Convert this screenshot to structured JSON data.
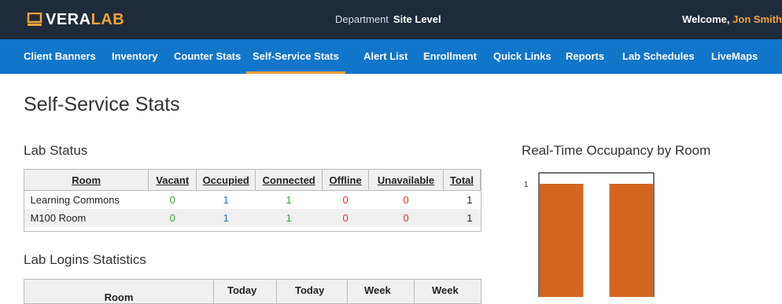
{
  "header": {
    "logo": {
      "part1": "VERA",
      "part2": "LAB"
    },
    "department_label": "Department",
    "department_value": "Site Level",
    "welcome_label": "Welcome,",
    "user_name": "Jon Smith",
    "accent_color": "#f0a23a"
  },
  "nav": {
    "items": [
      {
        "label": "Client Banners"
      },
      {
        "label": "Inventory"
      },
      {
        "label": "Counter Stats"
      },
      {
        "label": "Self-Service Stats"
      },
      {
        "label": "Alert List"
      },
      {
        "label": "Enrollment"
      },
      {
        "label": "Quick Links"
      },
      {
        "label": "Reports"
      },
      {
        "label": "Lab Schedules"
      },
      {
        "label": "LiveMaps"
      }
    ],
    "active": "Self-Service Stats"
  },
  "page": {
    "title": "Self-Service Stats"
  },
  "lab_status": {
    "title": "Lab Status",
    "columns": [
      "Room",
      "Vacant",
      "Occupied",
      "Connected",
      "Offline",
      "Unavailable",
      "Total"
    ],
    "rows": [
      {
        "room": "Learning Commons",
        "vacant": "0",
        "occupied": "1",
        "connected": "1",
        "offline": "0",
        "unavailable": "0",
        "total": "1"
      },
      {
        "room": "M100 Room",
        "vacant": "0",
        "occupied": "1",
        "connected": "1",
        "offline": "0",
        "unavailable": "0",
        "total": "1"
      }
    ]
  },
  "lab_logins": {
    "title": "Lab Logins Statistics",
    "columns": [
      "Room",
      "Today",
      "Today",
      "Week",
      "Week"
    ]
  },
  "chart_data": {
    "type": "bar",
    "title": "Real-Time Occupancy by Room",
    "categories": [
      "",
      ""
    ],
    "values": [
      1,
      1
    ],
    "ylim": [
      0,
      1
    ],
    "y_ticks": [
      "1"
    ],
    "bar_color": "#d2661f"
  }
}
